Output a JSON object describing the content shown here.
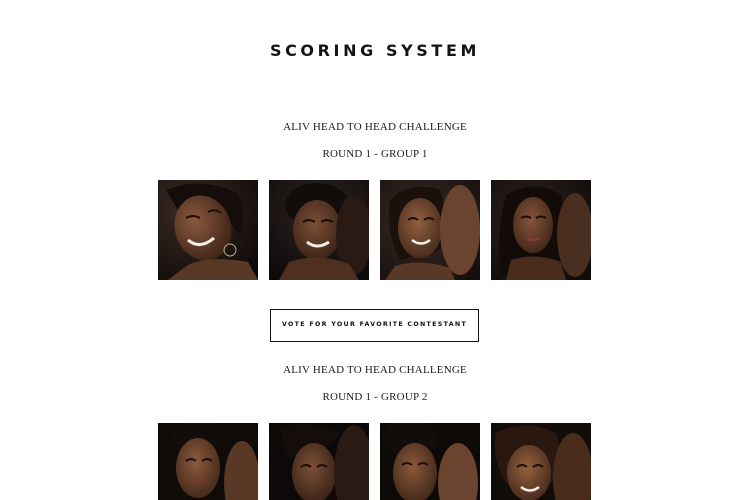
{
  "page": {
    "title": "SCORING SYSTEM"
  },
  "groups": [
    {
      "challenge": "ALIV HEAD TO HEAD CHALLENGE",
      "round": "ROUND 1 - GROUP 1",
      "photos": [
        "contestant-photo",
        "contestant-photo",
        "contestant-photo",
        "contestant-photo"
      ]
    },
    {
      "challenge": "ALIV HEAD TO HEAD CHALLENGE",
      "round": "ROUND 1 - GROUP 2",
      "photos": [
        "contestant-photo",
        "contestant-photo",
        "contestant-photo",
        "contestant-photo"
      ]
    }
  ],
  "vote_button": {
    "label": "VOTE FOR YOUR FAVORITE CONTESTANT"
  },
  "colors": {
    "text": "#141414",
    "background": "#ffffff",
    "border": "#111111"
  }
}
